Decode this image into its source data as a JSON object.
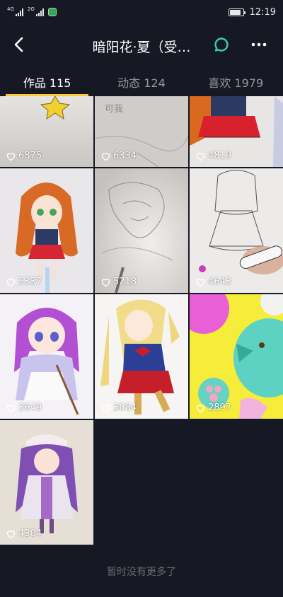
{
  "status_bar": {
    "net1": "4G",
    "net2": "2G",
    "time": "12:19",
    "battery_level": 0.85
  },
  "nav": {
    "title": "暗阳花·夏（受…",
    "back_icon": "chevron-left-icon",
    "chat_icon": "message-circle-icon",
    "more_icon": "more-horizontal-icon"
  },
  "tabs": [
    {
      "label": "作品 115",
      "active": true
    },
    {
      "label": "动态 124",
      "active": false
    },
    {
      "label": "喜欢 1979",
      "active": false
    }
  ],
  "grid": {
    "items": [
      {
        "likes": "6875"
      },
      {
        "likes": "6334"
      },
      {
        "likes": "4819"
      },
      {
        "likes": "5337"
      },
      {
        "likes": "5218"
      },
      {
        "likes": "4643"
      },
      {
        "likes": "3649"
      },
      {
        "likes": "3084"
      },
      {
        "likes": "2897"
      },
      {
        "likes": "4304"
      }
    ],
    "partial_text": "可我"
  },
  "footer": {
    "no_more": "暂时没有更多了"
  },
  "colors": {
    "background": "#161823",
    "tab_indicator": "#fcc73c",
    "chat_icon": "#2fd3a8"
  }
}
